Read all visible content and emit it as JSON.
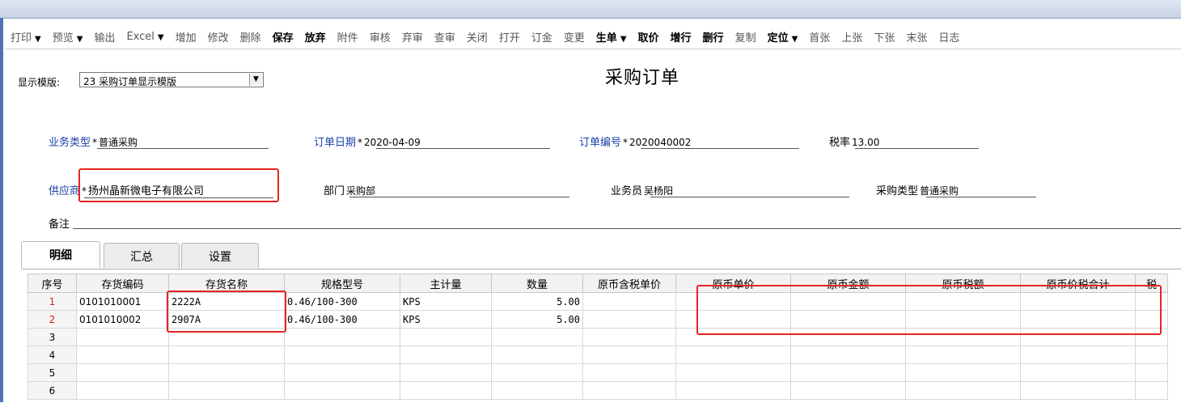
{
  "toolbar": {
    "items": [
      {
        "label": "打印",
        "caret": "▼",
        "enabled": false
      },
      {
        "label": "预览",
        "caret": "▼",
        "enabled": false
      },
      {
        "label": "输出",
        "caret": "",
        "enabled": false
      },
      {
        "label": "Excel",
        "caret": "▼",
        "enabled": false
      },
      {
        "label": "增加",
        "caret": "",
        "enabled": false
      },
      {
        "label": "修改",
        "caret": "",
        "enabled": false
      },
      {
        "label": "删除",
        "caret": "",
        "enabled": false
      },
      {
        "label": "保存",
        "caret": "",
        "enabled": true
      },
      {
        "label": "放弃",
        "caret": "",
        "enabled": true
      },
      {
        "label": "附件",
        "caret": "",
        "enabled": false
      },
      {
        "label": "审核",
        "caret": "",
        "enabled": false
      },
      {
        "label": "弃审",
        "caret": "",
        "enabled": false
      },
      {
        "label": "查审",
        "caret": "",
        "enabled": false
      },
      {
        "label": "关闭",
        "caret": "",
        "enabled": false
      },
      {
        "label": "打开",
        "caret": "",
        "enabled": false
      },
      {
        "label": "订金",
        "caret": "",
        "enabled": false
      },
      {
        "label": "变更",
        "caret": "",
        "enabled": false
      },
      {
        "label": "生单",
        "caret": "▼",
        "enabled": true
      },
      {
        "label": "取价",
        "caret": "",
        "enabled": true
      },
      {
        "label": "增行",
        "caret": "",
        "enabled": true
      },
      {
        "label": "删行",
        "caret": "",
        "enabled": true
      },
      {
        "label": "复制",
        "caret": "",
        "enabled": false
      },
      {
        "label": "定位",
        "caret": "▼",
        "enabled": true
      },
      {
        "label": "首张",
        "caret": "",
        "enabled": false
      },
      {
        "label": "上张",
        "caret": "",
        "enabled": false
      },
      {
        "label": "下张",
        "caret": "",
        "enabled": false
      },
      {
        "label": "末张",
        "caret": "",
        "enabled": false
      },
      {
        "label": "日志",
        "caret": "",
        "enabled": false
      }
    ]
  },
  "page_title": "采购订单",
  "template": {
    "label": "显示模版:",
    "value": "23 采购订单显示模版"
  },
  "fields": {
    "biz_type": {
      "label": "业务类型",
      "value": "普通采购"
    },
    "order_date": {
      "label": "订单日期",
      "value": "2020-04-09"
    },
    "order_no": {
      "label": "订单编号",
      "value": "2020040002"
    },
    "tax_rate": {
      "label": "税率",
      "value": "13.00"
    },
    "supplier": {
      "label": "供应商",
      "value": "扬州晶新微电子有限公司"
    },
    "dept": {
      "label": "部门",
      "value": "采购部"
    },
    "salesman": {
      "label": "业务员",
      "value": "吴杨阳"
    },
    "purchase_type": {
      "label": "采购类型",
      "value": "普通采购"
    },
    "remark": {
      "label": "备注",
      "value": ""
    }
  },
  "required_mark": "*",
  "tabs": [
    "明细",
    "汇总",
    "设置"
  ],
  "grid": {
    "headers": [
      "序号",
      "存货编码",
      "存货名称",
      "规格型号",
      "主计量",
      "数量",
      "原币含税单价",
      "原币单价",
      "原币金额",
      "原币税额",
      "原币价税合计",
      "税"
    ],
    "rows": [
      {
        "seq": "1",
        "code": "0101010001",
        "name": "2222A",
        "spec": "0.46/100-300",
        "unit": "KPS",
        "qty": "5.00"
      },
      {
        "seq": "2",
        "code": "0101010002",
        "name": "2907A",
        "spec": "0.46/100-300",
        "unit": "KPS",
        "qty": "5.00"
      },
      {
        "seq": "3",
        "code": "",
        "name": "",
        "spec": "",
        "unit": "",
        "qty": ""
      },
      {
        "seq": "4",
        "code": "",
        "name": "",
        "spec": "",
        "unit": "",
        "qty": ""
      },
      {
        "seq": "5",
        "code": "",
        "name": "",
        "spec": "",
        "unit": "",
        "qty": ""
      },
      {
        "seq": "6",
        "code": "",
        "name": "",
        "spec": "",
        "unit": "",
        "qty": ""
      }
    ]
  },
  "colors": {
    "highlight": "#e52620",
    "label_blue": "#1a3fa8",
    "row_num_red": "#d02020"
  }
}
